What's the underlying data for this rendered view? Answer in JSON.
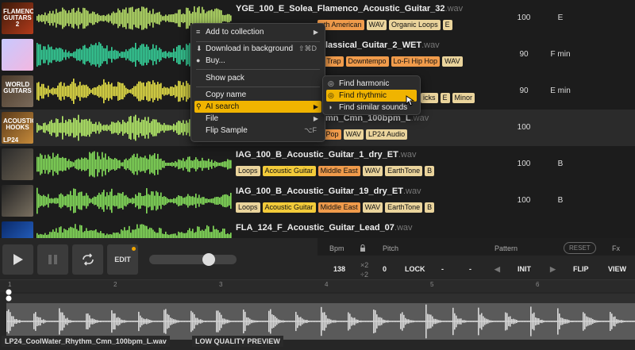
{
  "rows": [
    {
      "file_base": "YGE_100_E_Solea_Flamenco_Acoustic_Guitar_32",
      "ext": ".wav",
      "tags": [
        {
          "label": "uth American",
          "style": "o"
        },
        {
          "label": "WAV",
          "style": "l"
        },
        {
          "label": "Organic Loops",
          "style": "l"
        },
        {
          "label": "E",
          "style": "l"
        }
      ],
      "bpm": "100",
      "key": "E",
      "thumb_text": "FLAMENCO GUITARS 2",
      "wave_color": "#b9e26a"
    },
    {
      "file_base": "lassical_Guitar_2_WET",
      "ext": ".wav",
      "tags": [
        {
          "label": "ill Trap",
          "style": "o"
        },
        {
          "label": "Downtempo",
          "style": "o"
        },
        {
          "label": "Lo-Fi Hip Hop",
          "style": "o"
        },
        {
          "label": "WAV",
          "style": "l"
        }
      ],
      "bpm": "90",
      "key": "F min",
      "thumb_text": "",
      "wave_color": "#36d29a"
    },
    {
      "file_base": "",
      "ext": "",
      "tags": [
        {
          "label": "icks",
          "style": "l"
        },
        {
          "label": "E",
          "style": "l"
        },
        {
          "label": "Minor",
          "style": "l"
        }
      ],
      "bpm": "90",
      "key": "E min",
      "thumb_text": "WORLD GUITARS",
      "wave_color": "#e7e247"
    },
    {
      "file_base": "mn_Cmn_100bpm_L",
      "ext": ".wav",
      "tags": [
        {
          "label": "e Pop",
          "style": "o"
        },
        {
          "label": "WAV",
          "style": "l"
        },
        {
          "label": "LP24 Audio",
          "style": "l"
        }
      ],
      "bpm": "100",
      "key": "",
      "thumb_text": "ACOUSTIC HOOKS",
      "wave_color": "#b6ee6a"
    },
    {
      "file_base": "IAG_100_B_Acoustic_Guitar_1_dry_ET",
      "ext": ".wav",
      "tags": [
        {
          "label": "Loops",
          "style": "l"
        },
        {
          "label": "Acoustic Guitar",
          "style": "y"
        },
        {
          "label": "Middle East",
          "style": "o"
        },
        {
          "label": "WAV",
          "style": "l"
        },
        {
          "label": "EarthTone",
          "style": "l"
        },
        {
          "label": "B",
          "style": "l"
        }
      ],
      "bpm": "100",
      "key": "B",
      "thumb_text": "",
      "wave_color": "#86e05c"
    },
    {
      "file_base": "IAG_100_B_Acoustic_Guitar_19_dry_ET",
      "ext": ".wav",
      "tags": [
        {
          "label": "Loops",
          "style": "l"
        },
        {
          "label": "Acoustic Guitar",
          "style": "y"
        },
        {
          "label": "Middle East",
          "style": "o"
        },
        {
          "label": "WAV",
          "style": "l"
        },
        {
          "label": "EarthTone",
          "style": "l"
        },
        {
          "label": "B",
          "style": "l"
        }
      ],
      "bpm": "100",
      "key": "B",
      "thumb_text": "",
      "wave_color": "#86e05c"
    },
    {
      "file_base": "FLA_124_F_Acoustic_Guitar_Lead_07",
      "ext": ".wav",
      "tags": [],
      "bpm": "",
      "key": "",
      "thumb_text": "",
      "wave_color": "#86e05c"
    }
  ],
  "thumb_badge": "LP24",
  "context_menu": {
    "items": [
      {
        "label": "Add to collection",
        "icon": "list-add-icon",
        "glyph": "≡",
        "submenu": true
      },
      {
        "label": "Download in background",
        "icon": "download-icon",
        "glyph": "⬇",
        "shortcut": "⇧⌘D"
      },
      {
        "label": "Buy...",
        "icon": "coin-icon",
        "glyph": "●"
      },
      {
        "label": "Show pack"
      },
      {
        "label": "Copy name"
      },
      {
        "label": "AI search",
        "icon": "search-icon",
        "glyph": "⚲",
        "submenu": true,
        "highlighted": true
      },
      {
        "label": "File",
        "submenu": true
      },
      {
        "label": "Flip Sample",
        "shortcut": "⌥F"
      }
    ]
  },
  "ai_submenu": {
    "items": [
      {
        "label": "Find harmonic matches",
        "icon": "harmonic-icon",
        "glyph": "◎"
      },
      {
        "label": "Find rhythmic matches",
        "icon": "rhythm-icon",
        "glyph": "◎",
        "highlighted": true
      },
      {
        "label": "Find similar sounds",
        "icon": "similar-icon",
        "glyph": "◑"
      }
    ]
  },
  "player": {
    "edit_label": "EDIT",
    "volume": 0.68,
    "labels": {
      "bpm": "Bpm",
      "pitch": "Pitch",
      "pattern": "Pattern",
      "reset": "RESET",
      "fx": "Fx"
    },
    "values": {
      "bpm": "138",
      "half": "×2",
      "double": "÷2",
      "pitch": "0",
      "lock": "LOCK",
      "dash1": "-",
      "dash2": "-",
      "init": "INIT",
      "flip": "FLIP",
      "view": "VIEW"
    },
    "ruler_marks": [
      "1",
      "2",
      "3",
      "4",
      "5",
      "6",
      "7"
    ],
    "current_file": "LP24_CoolWater_Rhythm_Cmn_100bpm_L.wav",
    "quality_label": "LOW QUALITY PREVIEW"
  },
  "colors": {
    "accent": "#f0b400",
    "tag_orange": "#f09b4b",
    "tag_yellow": "#f3cb3a",
    "tag_light": "#ead49c"
  }
}
